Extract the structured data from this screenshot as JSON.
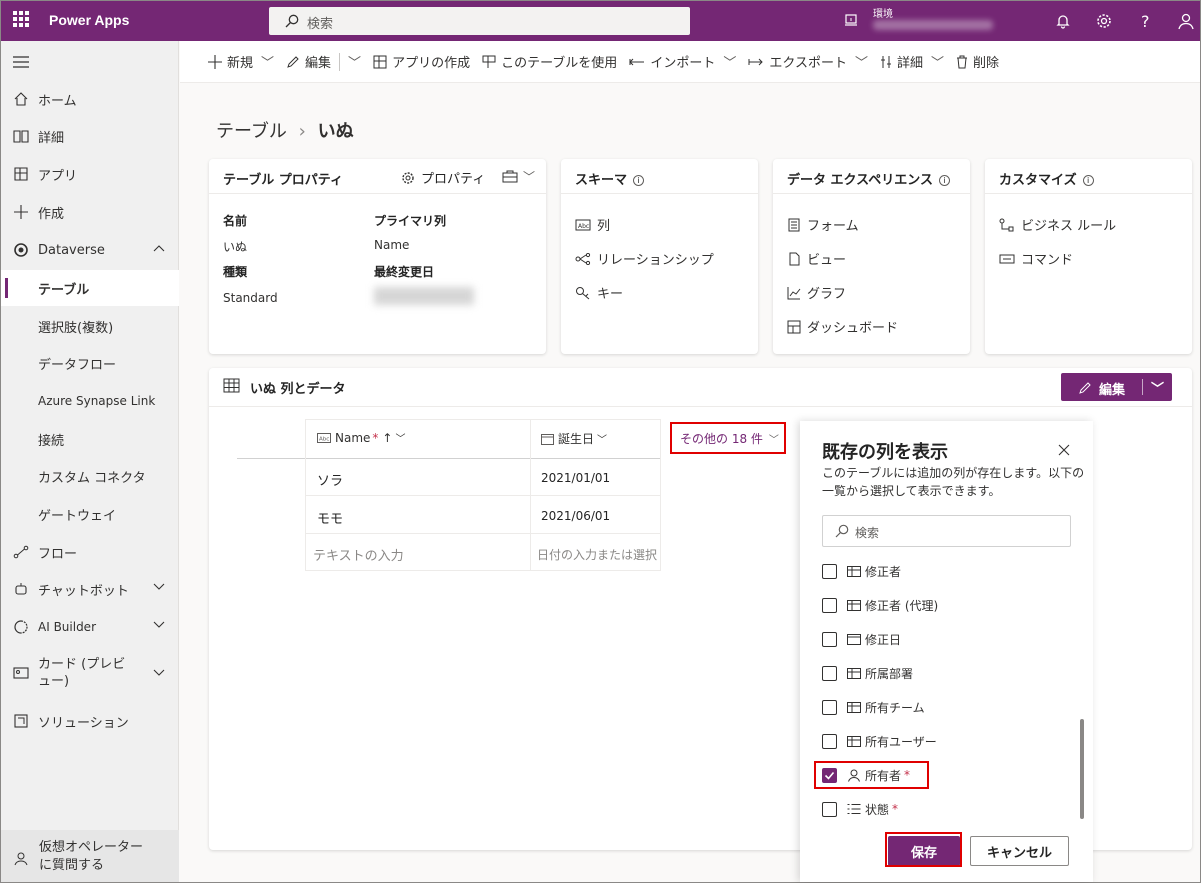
{
  "app": {
    "title": "Power Apps",
    "search_placeholder": "検索",
    "env_label": "環境"
  },
  "sidebar": {
    "items": [
      {
        "label": "ホーム",
        "icon": "home-icon"
      },
      {
        "label": "詳細",
        "icon": "book-icon"
      },
      {
        "label": "アプリ",
        "icon": "apps-icon"
      },
      {
        "label": "作成",
        "icon": "plus-icon"
      },
      {
        "label": "Dataverse",
        "icon": "dataverse-icon"
      },
      {
        "label": "テーブル"
      },
      {
        "label": "選択肢(複数)"
      },
      {
        "label": "データフロー"
      },
      {
        "label": "Azure Synapse Link"
      },
      {
        "label": "接続"
      },
      {
        "label": "カスタム コネクタ"
      },
      {
        "label": "ゲートウェイ"
      },
      {
        "label": "フロー",
        "icon": "flow-icon"
      },
      {
        "label": "チャットボット",
        "icon": "bot-icon"
      },
      {
        "label": "AI Builder",
        "icon": "ai-builder-icon"
      },
      {
        "label": "カード (プレビュー)",
        "icon": "card-icon"
      },
      {
        "label": "ソリューション",
        "icon": "solution-icon"
      }
    ],
    "virtual_agent": "仮想オペレーターに質問する"
  },
  "commandbar": {
    "new": "新規",
    "edit": "編集",
    "create_app": "アプリの作成",
    "use_table": "このテーブルを使用",
    "import": "インポート",
    "export": "エクスポート",
    "details": "詳細",
    "delete": "削除"
  },
  "breadcrumb": {
    "parent": "テーブル",
    "current": "いぬ"
  },
  "props": {
    "title": "テーブル プロパティ",
    "properties_btn": "プロパティ",
    "name_label": "名前",
    "name_value": "いぬ",
    "primary_label": "プライマリ列",
    "primary_value": "Name",
    "type_label": "種類",
    "type_value": "Standard",
    "modified_label": "最終変更日"
  },
  "schema": {
    "title": "スキーマ",
    "columns": "列",
    "relations": "リレーションシップ",
    "keys": "キー"
  },
  "dataexp": {
    "title": "データ エクスペリエンス",
    "forms": "フォーム",
    "views": "ビュー",
    "charts": "グラフ",
    "dashboards": "ダッシュボード"
  },
  "customize": {
    "title": "カスタマイズ",
    "business_rules": "ビジネス ルール",
    "commands": "コマンド"
  },
  "datasec": {
    "title": "いぬ 列とデータ",
    "edit": "編集"
  },
  "grid": {
    "col1": "Name",
    "col2": "誕生日",
    "more": "その他の 18 件",
    "rows": [
      [
        "ソラ",
        "2021/01/01"
      ],
      [
        "モモ",
        "2021/06/01"
      ]
    ],
    "ph1": "テキストの入力",
    "ph2": "日付の入力または選択"
  },
  "panel": {
    "title": "既存の列を表示",
    "desc": "このテーブルには追加の列が存在します。以下の一覧から選択して表示できます。",
    "search": "検索",
    "options": [
      {
        "label": "修正者",
        "checked": false,
        "req": ""
      },
      {
        "label": "修正者 (代理)",
        "checked": false,
        "req": ""
      },
      {
        "label": "修正日",
        "checked": false,
        "req": ""
      },
      {
        "label": "所属部署",
        "checked": false,
        "req": ""
      },
      {
        "label": "所有チーム",
        "checked": false,
        "req": ""
      },
      {
        "label": "所有ユーザー",
        "checked": false,
        "req": ""
      },
      {
        "label": "所有者",
        "checked": true,
        "req": "*"
      },
      {
        "label": "状態",
        "checked": false,
        "req": "*"
      }
    ],
    "save": "保存",
    "cancel": "キャンセル"
  },
  "colors": {
    "brand": "#742774",
    "highlight": "#e00000"
  }
}
